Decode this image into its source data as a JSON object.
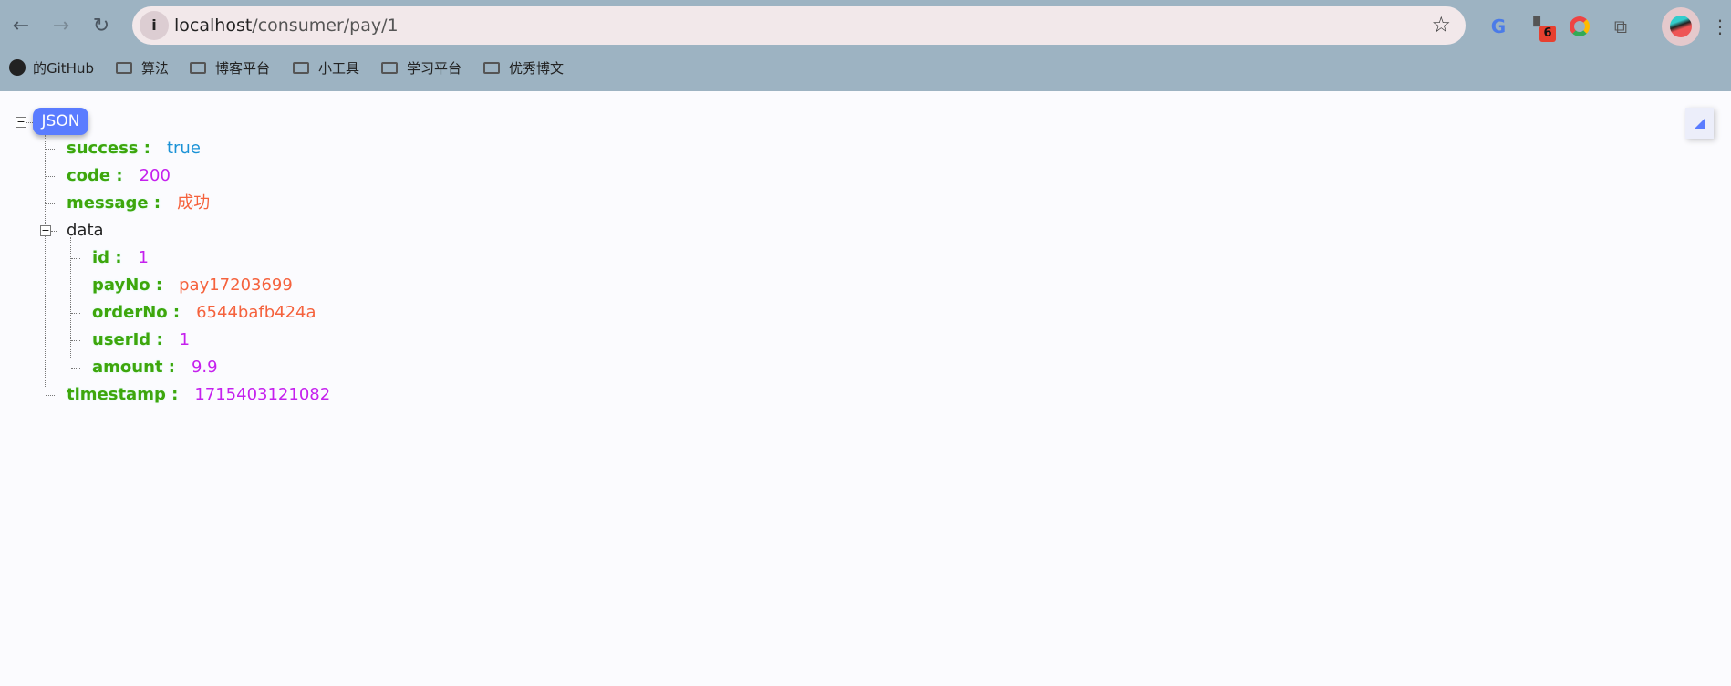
{
  "browser": {
    "url_host": "localhost",
    "url_path": "/consumer/pay/1",
    "extension_badge": "6",
    "bookmarks": [
      {
        "label": "的GitHub",
        "icon": "github-icon"
      },
      {
        "label": "算法",
        "icon": "folder-icon"
      },
      {
        "label": "博客平台",
        "icon": "folder-icon"
      },
      {
        "label": "小工具",
        "icon": "folder-icon"
      },
      {
        "label": "学习平台",
        "icon": "folder-icon"
      },
      {
        "label": "优秀博文",
        "icon": "folder-icon"
      }
    ]
  },
  "viewer": {
    "root_label": "JSON",
    "fields": [
      {
        "key": "success :",
        "value": "true"
      },
      {
        "key": "code :",
        "value": "200"
      },
      {
        "key": "message :",
        "value": "成功"
      },
      {
        "key": "data"
      },
      {
        "key": "timestamp :",
        "value": "1715403121082"
      }
    ],
    "data_fields": [
      {
        "key": "id :",
        "value": "1"
      },
      {
        "key": "payNo :",
        "value": "pay17203699"
      },
      {
        "key": "orderNo :",
        "value": "6544bafb424a"
      },
      {
        "key": "userId :",
        "value": "1"
      },
      {
        "key": "amount :",
        "value": "9.9"
      }
    ]
  },
  "colors": {
    "key": "#3ea60c",
    "string": "#f5623d",
    "number": "#c520ee",
    "boolean": "#1b92d6",
    "badge": "#5a7cff"
  }
}
